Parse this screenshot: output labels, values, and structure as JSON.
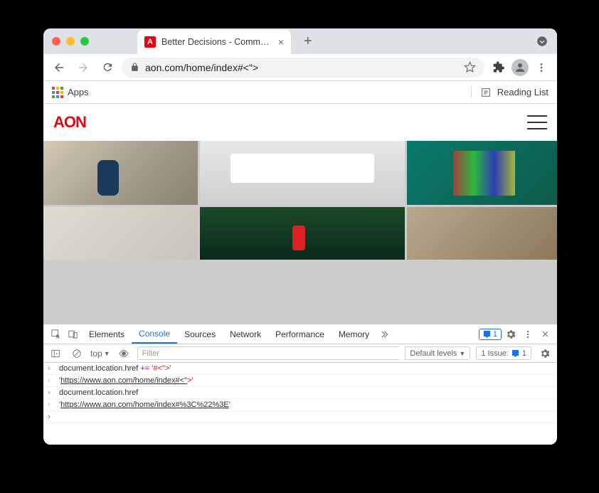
{
  "browser": {
    "tab_title": "Better Decisions - Commercial",
    "url_display": "aon.com/home/index#<\">",
    "bookmarks": {
      "apps": "Apps",
      "reading_list": "Reading List"
    }
  },
  "site": {
    "logo": "AON"
  },
  "devtools": {
    "tabs": [
      "Elements",
      "Console",
      "Sources",
      "Network",
      "Performance",
      "Memory"
    ],
    "active_tab": "Console",
    "badge_count": "1",
    "toolbar": {
      "context": "top",
      "filter_placeholder": "Filter",
      "levels": "Default levels",
      "issues_label": "1 Issue:",
      "issues_count": "1"
    },
    "console": [
      {
        "dir": "in",
        "plain": "document.location.href ",
        "op": "+=",
        "str": " '#<\">'"
      },
      {
        "dir": "out",
        "q1": "'",
        "url": "https://www.aon.com/home/index#<\"",
        "hl": ">",
        "q2": "'"
      },
      {
        "dir": "in",
        "plain": "document.location.href"
      },
      {
        "dir": "out",
        "q1": "'",
        "url": "https://www.aon.com/home/index#%3C%22%3E",
        "q2": "'"
      }
    ]
  }
}
